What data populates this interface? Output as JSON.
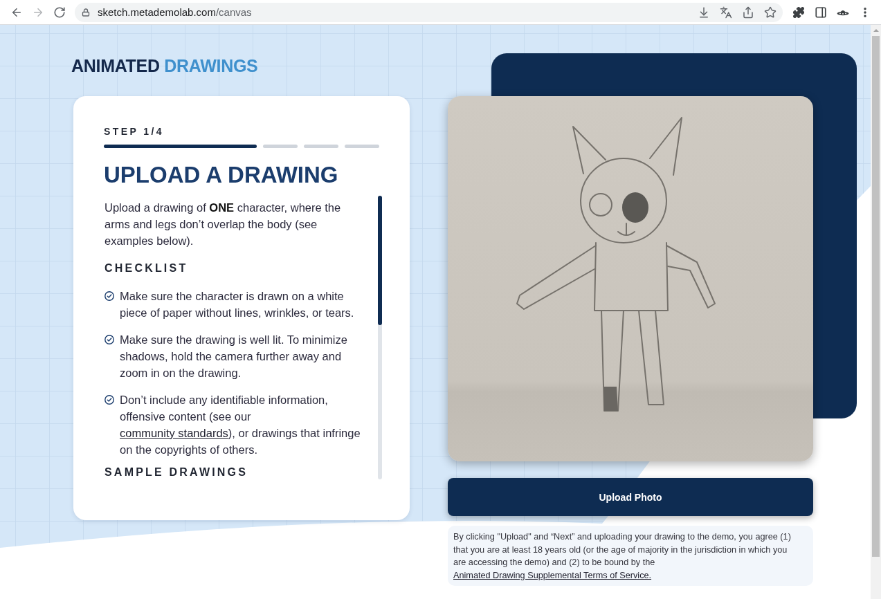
{
  "browser": {
    "url_host": "sketch.metademolab.com",
    "url_path": "/canvas"
  },
  "logo": {
    "text_1": "ANIMATED",
    "text_2": "DRAWINGS"
  },
  "step_card": {
    "step_label": "STEP 1/4",
    "progress_segments": [
      {
        "done": true
      },
      {
        "done": false
      },
      {
        "done": false
      },
      {
        "done": false
      }
    ],
    "title": "UPLOAD A DRAWING",
    "intro": "Upload a drawing of **ONE** character, where the arms and legs don’t overlap the body (see examples below).",
    "checklist_heading": "CHECKLIST",
    "checklist": [
      {
        "text": "Make sure the character is drawn on a white piece of paper without lines, wrinkles, or tears."
      },
      {
        "text": "Make sure the drawing is well lit. To minimize shadows, hold the camera further away and zoom in on the drawing."
      },
      {
        "text": "Don’t include any identifiable information, offensive content (see our ",
        "link": "community standards",
        "text_after": "), or drawings that infringe on the copyrights of others."
      }
    ],
    "next_heading": "SAMPLE DRAWINGS"
  },
  "upload_button": {
    "label": "Upload Photo"
  },
  "disclaimer": {
    "text": "By clicking \"Upload\" and “Next” and uploading your drawing to the demo, you agree (1) that you are at least 18 years old (or the age of majority in the jurisdiction in which you are accessing the demo) and (2) to be bound by the ",
    "link": "Animated Drawing Supplemental Terms of Service."
  }
}
